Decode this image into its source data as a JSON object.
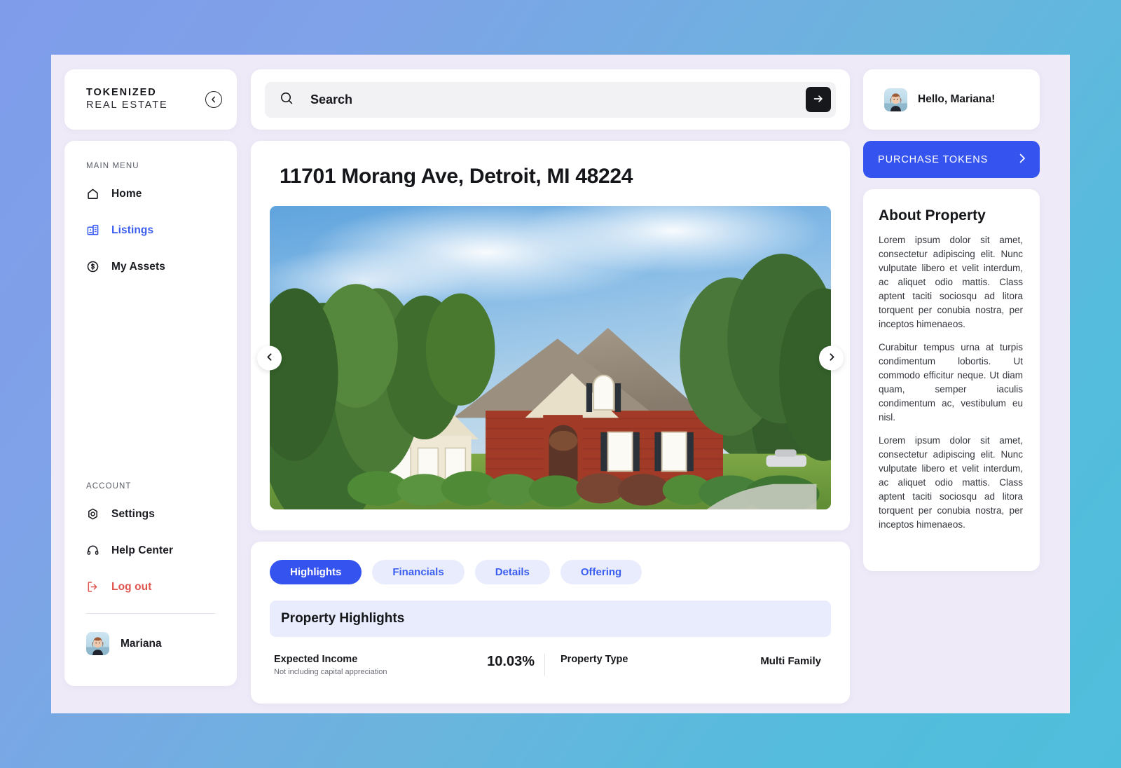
{
  "brand": {
    "line1": "TOKENIZED",
    "line2": "REAL ESTATE",
    "collapse_icon": "chevron-left-circle-icon"
  },
  "sidebar": {
    "main_menu_label": "MAIN MENU",
    "account_label": "ACCOUNT",
    "main_items": [
      {
        "label": "Home",
        "icon": "home-icon",
        "active": false
      },
      {
        "label": "Listings",
        "icon": "building-icon",
        "active": true
      },
      {
        "label": "My Assets",
        "icon": "dollar-circle-icon",
        "active": false
      }
    ],
    "account_items": [
      {
        "label": "Settings",
        "icon": "gear-icon",
        "danger": false
      },
      {
        "label": "Help Center",
        "icon": "headset-icon",
        "danger": false
      },
      {
        "label": "Log out",
        "icon": "logout-icon",
        "danger": true
      }
    ],
    "profile": {
      "name": "Mariana",
      "avatar": "user-avatar"
    }
  },
  "search": {
    "placeholder": "Search",
    "value": "",
    "icon": "search-icon",
    "submit_icon": "arrow-right-icon"
  },
  "header": {
    "greeting": "Hello, Mariana!",
    "avatar": "user-avatar",
    "purchase_label": "PURCHASE TOKENS",
    "purchase_icon": "chevron-right-icon"
  },
  "property": {
    "title": "11701 Morang Ave, Detroit, MI 48224",
    "gallery": {
      "alt": "Brick two-story suburban house with landscaped front yard",
      "prev_icon": "chevron-left-icon",
      "next_icon": "chevron-right-icon"
    }
  },
  "tabs": [
    {
      "label": "Highlights",
      "active": true
    },
    {
      "label": "Financials",
      "active": false
    },
    {
      "label": "Details",
      "active": false
    },
    {
      "label": "Offering",
      "active": false
    }
  ],
  "highlights": {
    "section_title": "Property Highlights",
    "rows": [
      {
        "label": "Expected Income",
        "sublabel": "Not including capital appreciation",
        "value": "10.03%",
        "value_size": "large"
      },
      {
        "label": "Property Type",
        "sublabel": "",
        "value": "Multi Family",
        "value_size": "small"
      }
    ]
  },
  "about": {
    "title": "About Property",
    "paragraphs": [
      "Lorem ipsum dolor sit amet, consectetur adipiscing elit. Nunc vulputate libero et velit interdum, ac aliquet odio mattis. Class aptent taciti sociosqu ad litora torquent per conubia nostra, per inceptos himenaeos.",
      "Curabitur tempus urna at turpis condimentum lobortis. Ut commodo efficitur neque. Ut diam quam, semper iaculis condimentum ac, vestibulum eu nisl.",
      "Lorem ipsum dolor sit amet, consectetur adipiscing elit. Nunc vulputate libero et velit interdum, ac aliquet odio mattis. Class aptent taciti sociosqu ad litora torquent per conubia nostra, per inceptos himenaeos."
    ]
  },
  "colors": {
    "accent": "#3553ee",
    "accent_soft": "#e9ecfc",
    "danger": "#e0544e",
    "shell_bg": "#eeeaf8",
    "card_bg": "#ffffff",
    "text": "#15161a"
  }
}
